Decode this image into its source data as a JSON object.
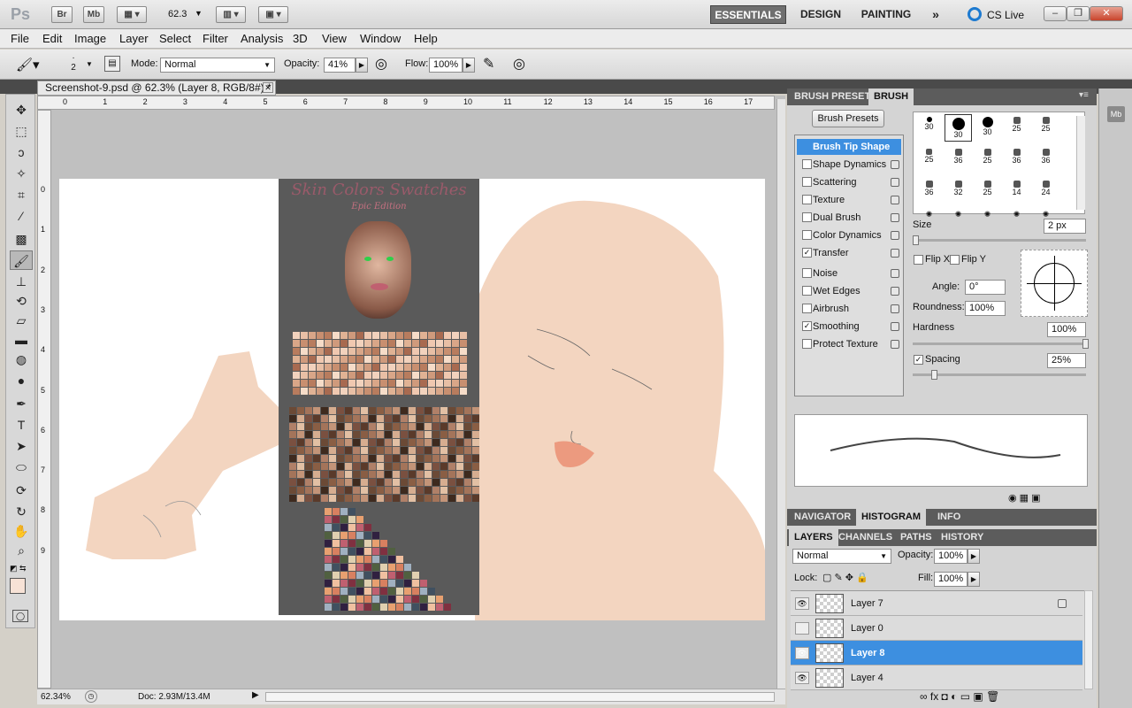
{
  "appbar": {
    "logo": "Ps",
    "bridge": "Br",
    "minibridge": "Mb",
    "zoom": "62.3",
    "workspaces": [
      "ESSENTIALS",
      "DESIGN",
      "PAINTING"
    ],
    "more": "»",
    "cslive": "CS Live"
  },
  "menu": [
    "File",
    "Edit",
    "Image",
    "Layer",
    "Select",
    "Filter",
    "Analysis",
    "3D",
    "View",
    "Window",
    "Help"
  ],
  "options": {
    "brush_size": "2",
    "mode_label": "Mode:",
    "mode_value": "Normal",
    "opacity_label": "Opacity:",
    "opacity_value": "41%",
    "flow_label": "Flow:",
    "flow_value": "100%"
  },
  "document": {
    "tab_title": "Screenshot-9.psd @ 62.3% (Layer 8, RGB/8#) *",
    "ruler_h": [
      "0",
      "1",
      "2",
      "3",
      "4",
      "5",
      "6",
      "7",
      "8",
      "9",
      "10",
      "11",
      "12",
      "13",
      "14",
      "15",
      "16",
      "17"
    ],
    "ruler_v": [
      "0",
      "1",
      "2",
      "3",
      "4",
      "5",
      "6",
      "7",
      "8",
      "9"
    ],
    "swatch_title": "Skin Colors Swatches",
    "swatch_subtitle": "Epic Edition",
    "status_zoom": "62.34%",
    "status_doc": "Doc: 2.93M/13.4M"
  },
  "brush_panel": {
    "tabs": [
      "BRUSH PRESETS",
      "BRUSH"
    ],
    "presets_button": "Brush Presets",
    "options": [
      {
        "label": "Brush Tip Shape",
        "checked": null,
        "lock": false,
        "selected": true
      },
      {
        "label": "Shape Dynamics",
        "checked": false,
        "lock": true
      },
      {
        "label": "Scattering",
        "checked": false,
        "lock": true
      },
      {
        "label": "Texture",
        "checked": false,
        "lock": true
      },
      {
        "label": "Dual Brush",
        "checked": false,
        "lock": true
      },
      {
        "label": "Color Dynamics",
        "checked": false,
        "lock": true
      },
      {
        "label": "Transfer",
        "checked": true,
        "lock": true
      },
      {
        "label": "Noise",
        "checked": false,
        "lock": true
      },
      {
        "label": "Wet Edges",
        "checked": false,
        "lock": true
      },
      {
        "label": "Airbrush",
        "checked": false,
        "lock": true
      },
      {
        "label": "Smoothing",
        "checked": true,
        "lock": true
      },
      {
        "label": "Protect Texture",
        "checked": false,
        "lock": true
      }
    ],
    "tips": [
      "30",
      "30",
      "30",
      "25",
      "25",
      "25",
      "36",
      "25",
      "36",
      "36",
      "36",
      "32",
      "25",
      "14",
      "24"
    ],
    "size_label": "Size",
    "size_value": "2 px",
    "flipx": "Flip X",
    "flipy": "Flip Y",
    "angle_label": "Angle:",
    "angle_value": "0°",
    "roundness_label": "Roundness:",
    "roundness_value": "100%",
    "hardness_label": "Hardness",
    "hardness_value": "100%",
    "spacing_label": "Spacing",
    "spacing_value": "25%"
  },
  "nav_tabs": [
    "NAVIGATOR",
    "HISTOGRAM",
    "INFO"
  ],
  "layers_panel": {
    "tabs": [
      "LAYERS",
      "CHANNELS",
      "PATHS",
      "HISTORY"
    ],
    "blend": "Normal",
    "opacity_label": "Opacity:",
    "opacity_value": "100%",
    "lock_label": "Lock:",
    "fill_label": "Fill:",
    "fill_value": "100%",
    "layers": [
      {
        "name": "Layer 7",
        "visible": true,
        "locked": true,
        "selected": false
      },
      {
        "name": "Layer 0",
        "visible": false,
        "locked": false,
        "selected": false
      },
      {
        "name": "Layer 8",
        "visible": true,
        "locked": false,
        "selected": true
      },
      {
        "name": "Layer 4",
        "visible": true,
        "locked": false,
        "selected": false
      }
    ]
  },
  "colors": {
    "foreground": "#f7e2d6",
    "skin": "#f3d5c0",
    "swatch_bg": "#5a5a5a",
    "selection": "#3d8fe0"
  }
}
